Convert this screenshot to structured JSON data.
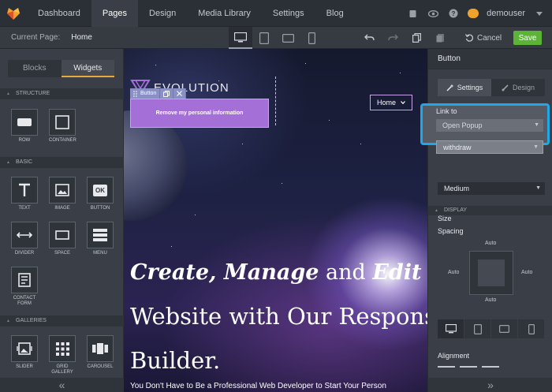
{
  "topbar": {
    "nav": [
      "Dashboard",
      "Pages",
      "Design",
      "Media Library",
      "Settings",
      "Blog"
    ],
    "active_nav": "Pages",
    "username": "demouser",
    "brand_color": "#f0a32b"
  },
  "subbar": {
    "current_page_label": "Current Page:",
    "current_page_value": "Home",
    "cancel_label": "Cancel",
    "save_label": "Save",
    "save_color": "#5bb436"
  },
  "left_panel": {
    "tabs": [
      "Blocks",
      "Widgets"
    ],
    "active_tab": "Widgets",
    "sections": {
      "structure": "STRUCTURE",
      "basic": "BASIC",
      "galleries": "GALLERIES"
    },
    "structure_widgets": [
      "ROW",
      "CONTAINER"
    ],
    "basic_widgets": [
      "TEXT",
      "IMAGE",
      "BUTTON",
      "DIVIDER",
      "SPACE",
      "MENU",
      "CONTACT FORM"
    ],
    "gallery_widgets": [
      "SLIDER",
      "GRID GALLERY",
      "CAROUSEL"
    ],
    "button_icon_text": "OK"
  },
  "canvas": {
    "brand_text": "EVOLUTION",
    "home_menu": "Home",
    "button_toolbar_label": "Button",
    "selected_button_text": "Remove my personal information",
    "hero_line1_a": "Create, Manage",
    "hero_line1_b": " and ",
    "hero_line1_c": "Edit You",
    "hero_line2": "Website with Our Responsive",
    "hero_line3": "Builder.",
    "hero_sub": "You Don't Have to Be a Professional Web Developer to Start Your Person"
  },
  "right_panel": {
    "title": "Button",
    "tabs": [
      "Settings",
      "Design"
    ],
    "active_tab": "Settings",
    "link_to_label": "Link to",
    "link_to_value": "Open Popup",
    "popup_value": "withdraw",
    "size_label": "Size",
    "size_value": "Medium",
    "display_section": "DISPLAY",
    "spacing_label": "Spacing",
    "spacing_top": "Auto",
    "spacing_left": "Auto",
    "spacing_right": "Auto",
    "spacing_bottom": "Auto",
    "alignment_label": "Alignment",
    "highlight_color": "#1ea8e8"
  }
}
